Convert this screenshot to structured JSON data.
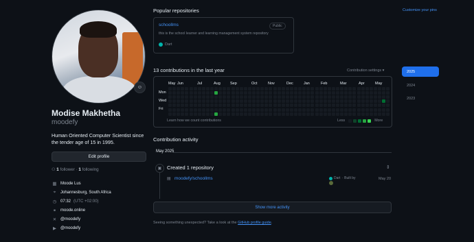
{
  "profile": {
    "name": "Modise Makhetha",
    "username": "moodefy",
    "bio": "Human Oriented Computer Scientist since the tender age of 15 in 1995.",
    "edit_label": "Edit profile",
    "followers_count": "1",
    "followers_label": "follower",
    "following_count": "1",
    "following_label": "following",
    "meta": {
      "company": "Moode Lus",
      "location": "Johannesburg, South Africa",
      "time": "07:32",
      "timezone": "(UTC +02:00)",
      "website": "moode.online",
      "x_handle": "@moodefy",
      "youtube": "@moodefy"
    }
  },
  "popular": {
    "title": "Popular repositories",
    "customize_label": "Customize your pins",
    "repo": {
      "name": "schoollms",
      "visibility": "Public",
      "description": "this is the school learner and learning management system repository",
      "language": "Dart",
      "language_color": "#00B4AB"
    }
  },
  "contributions": {
    "title": "13 contributions in the last year",
    "settings_label": "Contribution settings",
    "months": [
      "May",
      "Jun",
      "Jul",
      "Aug",
      "Sep",
      "Oct",
      "Nov",
      "Dec",
      "Jan",
      "Feb",
      "Mar",
      "Apr",
      "May"
    ],
    "days": [
      "Mon",
      "Wed",
      "Fri"
    ],
    "learn_label": "Learn how we count contributions",
    "less_label": "Less",
    "more_label": "More",
    "colors": [
      "#161b22",
      "#0e4429",
      "#006d32",
      "#26a641",
      "#39d353"
    ],
    "active_cells": [
      {
        "week": 11,
        "day": 1,
        "level": 3
      },
      {
        "week": 11,
        "day": 6,
        "level": 3
      },
      {
        "week": 51,
        "day": 3,
        "level": 2
      }
    ]
  },
  "years": [
    "2025",
    "2024",
    "2023"
  ],
  "activity": {
    "title": "Contribution activity",
    "month": "May 2025",
    "created_label": "Created 1 repository",
    "repo_link": "moodefy/schoollms",
    "repo_language": "Dart",
    "built_by": "Built by",
    "date": "May 20",
    "show_more": "Show more activity"
  },
  "footer": {
    "text": "Seeing something unexpected? Take a look at the",
    "link": "GitHub profile guide",
    "end": "."
  }
}
